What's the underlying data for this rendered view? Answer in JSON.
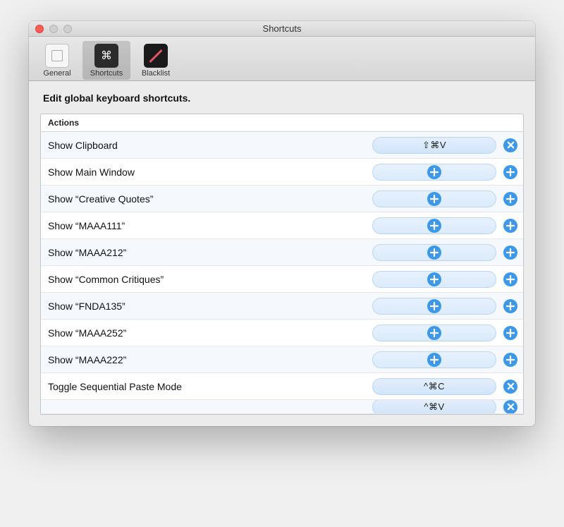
{
  "window": {
    "title": "Shortcuts"
  },
  "toolbar": {
    "items": [
      {
        "label": "General"
      },
      {
        "label": "Shortcuts"
      },
      {
        "label": "Blacklist"
      }
    ]
  },
  "heading": "Edit global keyboard shortcuts.",
  "table": {
    "header": "Actions",
    "rows": [
      {
        "label": "Show Clipboard",
        "shortcut": "⇧⌘V",
        "has_shortcut": true
      },
      {
        "label": "Show Main Window",
        "shortcut": "",
        "has_shortcut": false
      },
      {
        "label": "Show “Creative Quotes”",
        "shortcut": "",
        "has_shortcut": false
      },
      {
        "label": "Show “MAAA111”",
        "shortcut": "",
        "has_shortcut": false
      },
      {
        "label": "Show “MAAA212”",
        "shortcut": "",
        "has_shortcut": false
      },
      {
        "label": "Show “Common Critiques”",
        "shortcut": "",
        "has_shortcut": false
      },
      {
        "label": "Show “FNDA135”",
        "shortcut": "",
        "has_shortcut": false
      },
      {
        "label": "Show “MAAA252”",
        "shortcut": "",
        "has_shortcut": false
      },
      {
        "label": "Show “MAAA222”",
        "shortcut": "",
        "has_shortcut": false
      },
      {
        "label": "Toggle Sequential Paste Mode",
        "shortcut": "^⌘C",
        "has_shortcut": true
      },
      {
        "label": "",
        "shortcut": "^⌘V",
        "has_shortcut": true
      }
    ]
  }
}
